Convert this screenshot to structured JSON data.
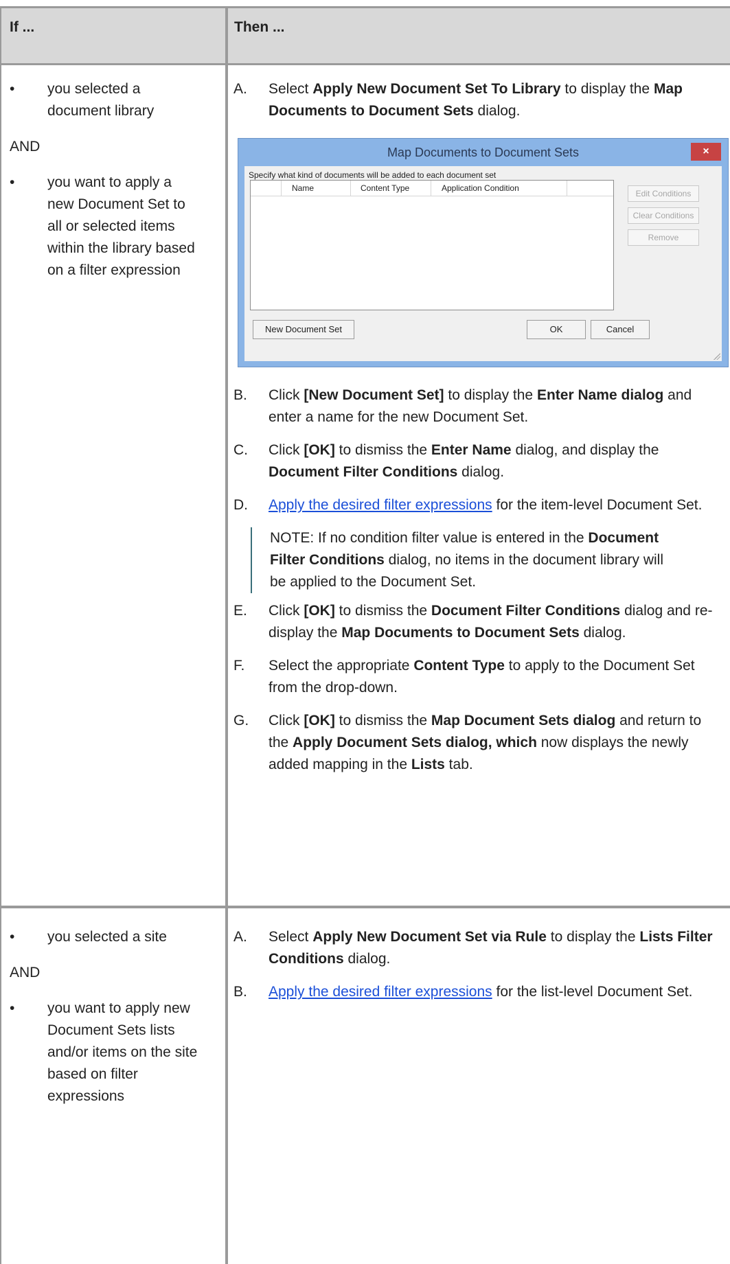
{
  "header": {
    "if_label": "If ...",
    "then_label": "Then ..."
  },
  "row1": {
    "left": {
      "bullet1": "you selected a document library",
      "and": "AND",
      "bullet2": "you want to apply a new Document Set to all or selected items within the library based on a filter expression"
    },
    "stepA": {
      "letter": "A.",
      "t1": "Select ",
      "b1": "Apply New Document Set To Library",
      "t2": " to display the ",
      "b2": "Map Documents to Document Sets",
      "t3": " dialog."
    },
    "dialog": {
      "title": "Map Documents to Document Sets",
      "close": "×",
      "prompt": "Specify what kind of documents will be added to each document set",
      "columns": [
        "Name",
        "Content Type",
        "Application Condition"
      ],
      "side_buttons": [
        "Edit Conditions",
        "Clear Conditions",
        "Remove"
      ],
      "new_button": "New Document Set",
      "ok": "OK",
      "cancel": "Cancel"
    },
    "stepB": {
      "letter": "B.",
      "t1": "Click ",
      "b1": "[New Document Set]",
      "t2": " to display the ",
      "b2": "Enter Name dialog",
      "t3": " and enter a name for the new Document Set."
    },
    "stepC": {
      "letter": "C.",
      "t1": "Click ",
      "b1": "[OK]",
      "t2": " to dismiss the ",
      "b2": "Enter Name",
      "t3": " dialog, and display the ",
      "b3": "Document Filter Conditions",
      "t4": " dialog."
    },
    "stepD": {
      "letter": "D.",
      "link": "Apply the desired filter expressions",
      "t1": " for the item-level Document Set."
    },
    "note": {
      "t1": "NOTE:  If no condition filter value is entered in the ",
      "b1": "Document Filter Conditions",
      "t2": " dialog, no items in the document library will be applied to the Document Set."
    },
    "stepE": {
      "letter": "E.",
      "t1": "Click ",
      "b1": "[OK]",
      "t2": " to dismiss the ",
      "b2": "Document Filter Conditions",
      "t3": " dialog and re-display the ",
      "b3": "Map Documents to Document Sets",
      "t4": " dialog."
    },
    "stepF": {
      "letter": "F.",
      "t1": "Select the appropriate ",
      "b1": "Content Type",
      "t2": " to apply to the Document Set from the drop-down."
    },
    "stepG": {
      "letter": "G.",
      "t1": "Click ",
      "b1": "[OK]",
      "t2": " to dismiss the ",
      "b2": "Map Document Sets dialog",
      "t3": " and return to the ",
      "b3": "Apply Document Sets dialog, which",
      "t4": " now displays the newly added mapping in the ",
      "b4": "Lists",
      "t5": " tab."
    }
  },
  "row2": {
    "left": {
      "bullet1": "you selected a site",
      "and": "AND",
      "bullet2": "you want to apply new Document Sets lists and/or items on the site based on filter expressions"
    },
    "stepA": {
      "letter": "A.",
      "t1": "Select ",
      "b1": "Apply New Document Set via Rule",
      "t2": " to display the ",
      "b2": "Lists Filter Conditions",
      "t3": " dialog."
    },
    "stepB": {
      "letter": "B.",
      "link": "Apply the desired filter expressions",
      "t1": " for the list-level Document Set."
    }
  }
}
